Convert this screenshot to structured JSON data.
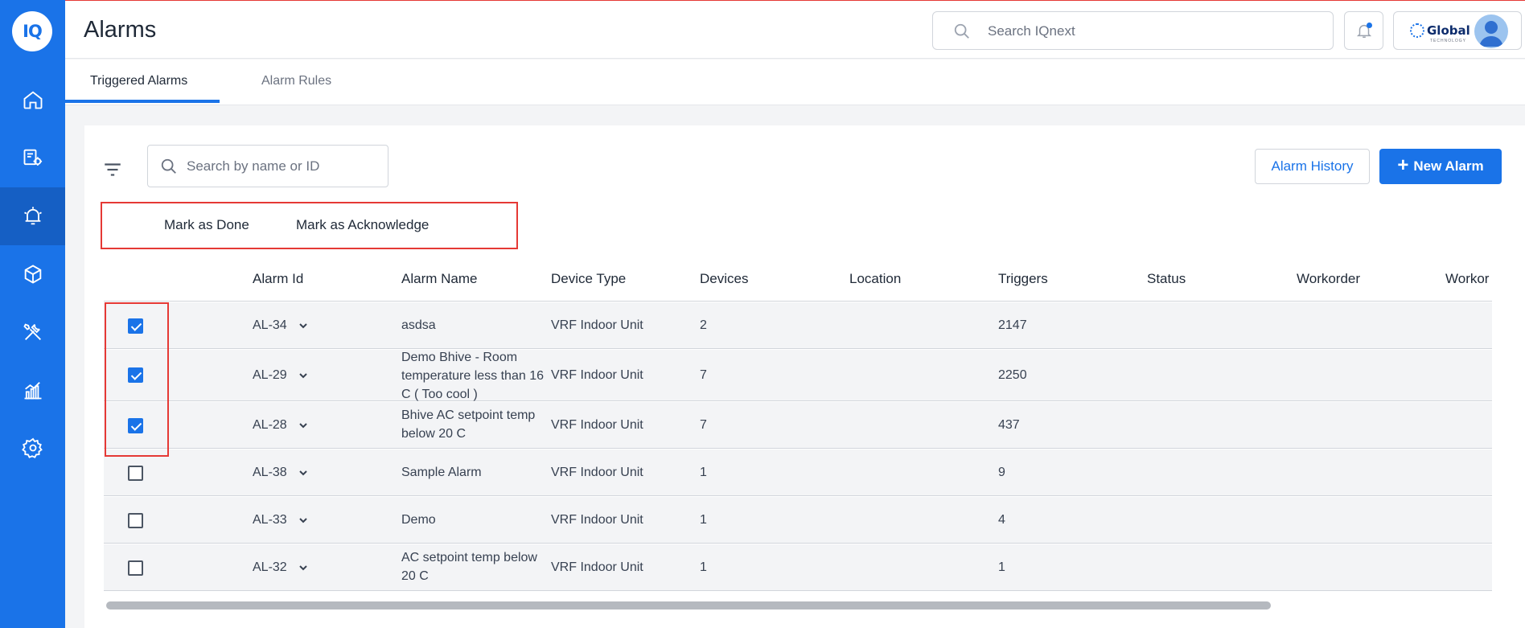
{
  "app": {
    "logo_text": "IQ",
    "page_title": "Alarms",
    "search_placeholder": "Search IQnext",
    "brand_name": "Global",
    "brand_sub": "TECHNOLOGY"
  },
  "sidebar": {
    "items": [
      {
        "icon": "home-icon",
        "active": false
      },
      {
        "icon": "assets-settings-icon",
        "active": false
      },
      {
        "icon": "alarm-icon",
        "active": true
      },
      {
        "icon": "box-icon",
        "active": false
      },
      {
        "icon": "tools-icon",
        "active": false
      },
      {
        "icon": "analytics-icon",
        "active": false
      },
      {
        "icon": "gear-icon",
        "active": false
      }
    ]
  },
  "tabs": [
    {
      "label": "Triggered Alarms",
      "active": true
    },
    {
      "label": "Alarm Rules",
      "active": false
    }
  ],
  "toolbar": {
    "search_placeholder": "Search by name or ID",
    "history_label": "Alarm History",
    "new_label": "New Alarm",
    "bulk_actions": [
      "Mark as Done",
      "Mark as Acknowledge"
    ]
  },
  "table": {
    "columns": [
      "Alarm Id",
      "Alarm Name",
      "Device Type",
      "Devices",
      "Location",
      "Triggers",
      "Status",
      "Workorder",
      "Workor"
    ],
    "rows": [
      {
        "checked": true,
        "id": "AL-34",
        "name": "asdsa",
        "device_type": "VRF Indoor Unit",
        "devices": "2",
        "location": "",
        "triggers": "2147"
      },
      {
        "checked": true,
        "id": "AL-29",
        "name": "Demo Bhive - Room temperature less than 16 C ( Too cool )",
        "device_type": "VRF Indoor Unit",
        "devices": "7",
        "location": "",
        "triggers": "2250"
      },
      {
        "checked": true,
        "id": "AL-28",
        "name": "Bhive AC setpoint temp below 20 C",
        "device_type": "VRF Indoor Unit",
        "devices": "7",
        "location": "",
        "triggers": "437"
      },
      {
        "checked": false,
        "id": "AL-38",
        "name": "Sample Alarm",
        "device_type": "VRF Indoor Unit",
        "devices": "1",
        "location": "",
        "triggers": "9"
      },
      {
        "checked": false,
        "id": "AL-33",
        "name": "Demo",
        "device_type": "VRF Indoor Unit",
        "devices": "1",
        "location": "",
        "triggers": "4"
      },
      {
        "checked": false,
        "id": "AL-32",
        "name": "AC setpoint temp below 20 C",
        "device_type": "VRF Indoor Unit",
        "devices": "1",
        "location": "",
        "triggers": "1"
      }
    ]
  },
  "colors": {
    "primary": "#1a73e8",
    "sidebar_active": "#155fc4",
    "highlight_border": "#e53935"
  }
}
